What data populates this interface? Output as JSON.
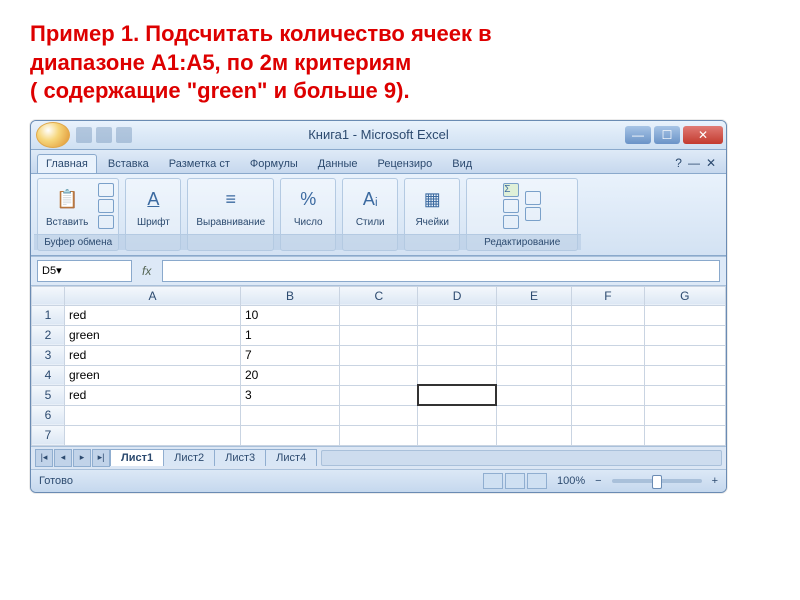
{
  "headline_l1": "Пример 1. Подсчитать количество ячеек в",
  "headline_l2": "диапазоне А1:А5, по 2м критериям",
  "headline_l3": "( содержащие \"green\"  и  больше 9).",
  "window_title": "Книга1 - Microsoft Excel",
  "tabs": [
    "Главная",
    "Вставка",
    "Разметка ст",
    "Формулы",
    "Данные",
    "Рецензиро",
    "Вид"
  ],
  "ribbon_groups": {
    "clipboard": {
      "paste": "Вставить",
      "label": "Буфер обмена"
    },
    "font": {
      "btn": "Шрифт",
      "label": "Шрифт"
    },
    "align": {
      "btn": "Выравнивание",
      "label": ""
    },
    "number": {
      "btn": "Число",
      "label": ""
    },
    "styles": {
      "btn": "Стили",
      "label": ""
    },
    "cells": {
      "btn": "Ячейки",
      "label": ""
    },
    "editing": {
      "label": "Редактирование"
    }
  },
  "namebox": "D5",
  "columns": [
    "A",
    "B",
    "C",
    "D",
    "E",
    "F",
    "G"
  ],
  "selected_col": "D",
  "selected_cell": {
    "row": 5,
    "col": "D"
  },
  "rows": [
    {
      "n": 1,
      "A": "red",
      "B": 10
    },
    {
      "n": 2,
      "A": "green",
      "B": 1
    },
    {
      "n": 3,
      "A": "red",
      "B": 7
    },
    {
      "n": 4,
      "A": "green",
      "B": 20
    },
    {
      "n": 5,
      "A": "red",
      "B": 3
    },
    {
      "n": 6
    },
    {
      "n": 7
    }
  ],
  "chart_data": {
    "type": "table",
    "title": "Spreadsheet cells A1:B5",
    "columns": [
      "A",
      "B"
    ],
    "data": [
      {
        "A": "red",
        "B": 10
      },
      {
        "A": "green",
        "B": 1
      },
      {
        "A": "red",
        "B": 7
      },
      {
        "A": "green",
        "B": 20
      },
      {
        "A": "red",
        "B": 3
      }
    ]
  },
  "sheet_tabs": [
    "Лист1",
    "Лист2",
    "Лист3",
    "Лист4"
  ],
  "status": "Готово",
  "zoom": "100%"
}
